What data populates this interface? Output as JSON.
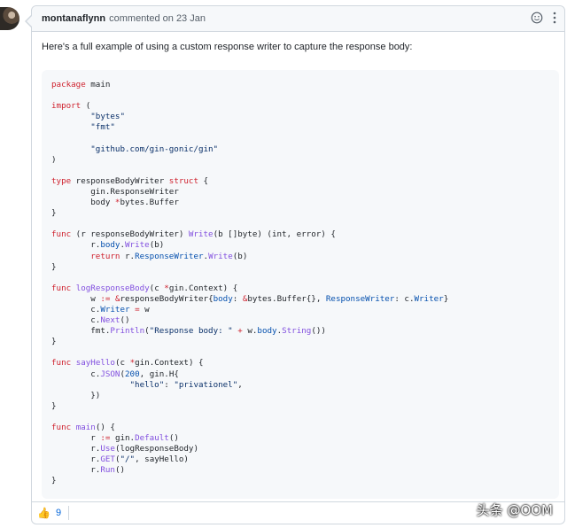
{
  "comment": {
    "author": "montanaflynn",
    "meta": "commented on 23 Jan",
    "intro": "Here's a full example of using a custom response writer to capture the response body:"
  },
  "icons": {
    "emoji": "smiley-icon",
    "more": "kebab-icon",
    "reaction": "thumbs-up-icon"
  },
  "reactions": {
    "emoji": "👍",
    "count": "9"
  },
  "watermark": "头条 @OOM",
  "code_lines": [
    [
      {
        "t": "package",
        "c": "kw"
      },
      {
        "t": " main"
      }
    ],
    [],
    [
      {
        "t": "import",
        "c": "kw"
      },
      {
        "t": " ("
      }
    ],
    [
      {
        "t": "        "
      },
      {
        "t": "\"bytes\"",
        "c": "st"
      }
    ],
    [
      {
        "t": "        "
      },
      {
        "t": "\"fmt\"",
        "c": "st"
      }
    ],
    [],
    [
      {
        "t": "        "
      },
      {
        "t": "\"github.com/gin-gonic/gin\"",
        "c": "st"
      }
    ],
    [
      {
        "t": ")"
      }
    ],
    [],
    [
      {
        "t": "type",
        "c": "kw"
      },
      {
        "t": " responseBodyWriter "
      },
      {
        "t": "struct",
        "c": "kw"
      },
      {
        "t": " {"
      }
    ],
    [
      {
        "t": "        gin.ResponseWriter"
      }
    ],
    [
      {
        "t": "        body "
      },
      {
        "t": "*",
        "c": "kw"
      },
      {
        "t": "bytes.Buffer"
      }
    ],
    [
      {
        "t": "}"
      }
    ],
    [],
    [
      {
        "t": "func",
        "c": "kw"
      },
      {
        "t": " (r responseBodyWriter) "
      },
      {
        "t": "Write",
        "c": "fn"
      },
      {
        "t": "(b []byte) (int, error) {"
      }
    ],
    [
      {
        "t": "        r."
      },
      {
        "t": "body",
        "c": "nm"
      },
      {
        "t": "."
      },
      {
        "t": "Write",
        "c": "fn"
      },
      {
        "t": "(b)"
      }
    ],
    [
      {
        "t": "        "
      },
      {
        "t": "return",
        "c": "kw"
      },
      {
        "t": " r."
      },
      {
        "t": "ResponseWriter",
        "c": "nm"
      },
      {
        "t": "."
      },
      {
        "t": "Write",
        "c": "fn"
      },
      {
        "t": "(b)"
      }
    ],
    [
      {
        "t": "}"
      }
    ],
    [],
    [
      {
        "t": "func",
        "c": "kw"
      },
      {
        "t": " "
      },
      {
        "t": "logResponseBody",
        "c": "fn"
      },
      {
        "t": "(c "
      },
      {
        "t": "*",
        "c": "kw"
      },
      {
        "t": "gin.Context) {"
      }
    ],
    [
      {
        "t": "        w "
      },
      {
        "t": ":=",
        "c": "kw"
      },
      {
        "t": " "
      },
      {
        "t": "&",
        "c": "kw"
      },
      {
        "t": "responseBodyWriter{"
      },
      {
        "t": "body",
        "c": "nm"
      },
      {
        "t": ": "
      },
      {
        "t": "&",
        "c": "kw"
      },
      {
        "t": "bytes.Buffer{}, "
      },
      {
        "t": "ResponseWriter",
        "c": "nm"
      },
      {
        "t": ": c."
      },
      {
        "t": "Writer",
        "c": "nm"
      },
      {
        "t": "}"
      }
    ],
    [
      {
        "t": "        c."
      },
      {
        "t": "Writer",
        "c": "nm"
      },
      {
        "t": " "
      },
      {
        "t": "=",
        "c": "kw"
      },
      {
        "t": " w"
      }
    ],
    [
      {
        "t": "        c."
      },
      {
        "t": "Next",
        "c": "fn"
      },
      {
        "t": "()"
      }
    ],
    [
      {
        "t": "        fmt."
      },
      {
        "t": "Println",
        "c": "fn"
      },
      {
        "t": "("
      },
      {
        "t": "\"Response body: \"",
        "c": "st"
      },
      {
        "t": " "
      },
      {
        "t": "+",
        "c": "kw"
      },
      {
        "t": " w."
      },
      {
        "t": "body",
        "c": "nm"
      },
      {
        "t": "."
      },
      {
        "t": "String",
        "c": "fn"
      },
      {
        "t": "())"
      }
    ],
    [
      {
        "t": "}"
      }
    ],
    [],
    [
      {
        "t": "func",
        "c": "kw"
      },
      {
        "t": " "
      },
      {
        "t": "sayHello",
        "c": "fn"
      },
      {
        "t": "(c "
      },
      {
        "t": "*",
        "c": "kw"
      },
      {
        "t": "gin.Context) {"
      }
    ],
    [
      {
        "t": "        c."
      },
      {
        "t": "JSON",
        "c": "fn"
      },
      {
        "t": "("
      },
      {
        "t": "200",
        "c": "nm"
      },
      {
        "t": ", gin.H{"
      }
    ],
    [
      {
        "t": "                "
      },
      {
        "t": "\"hello\"",
        "c": "st"
      },
      {
        "t": ": "
      },
      {
        "t": "\"privationel\"",
        "c": "st"
      },
      {
        "t": ","
      }
    ],
    [
      {
        "t": "        })"
      }
    ],
    [
      {
        "t": "}"
      }
    ],
    [],
    [
      {
        "t": "func",
        "c": "kw"
      },
      {
        "t": " "
      },
      {
        "t": "main",
        "c": "fn"
      },
      {
        "t": "() {"
      }
    ],
    [
      {
        "t": "        r "
      },
      {
        "t": ":=",
        "c": "kw"
      },
      {
        "t": " gin."
      },
      {
        "t": "Default",
        "c": "fn"
      },
      {
        "t": "()"
      }
    ],
    [
      {
        "t": "        r."
      },
      {
        "t": "Use",
        "c": "fn"
      },
      {
        "t": "(logResponseBody)"
      }
    ],
    [
      {
        "t": "        r."
      },
      {
        "t": "GET",
        "c": "fn"
      },
      {
        "t": "("
      },
      {
        "t": "\"/\"",
        "c": "st"
      },
      {
        "t": ", sayHello)"
      }
    ],
    [
      {
        "t": "        r."
      },
      {
        "t": "Run",
        "c": "fn"
      },
      {
        "t": "()"
      }
    ],
    [
      {
        "t": "}"
      }
    ]
  ]
}
